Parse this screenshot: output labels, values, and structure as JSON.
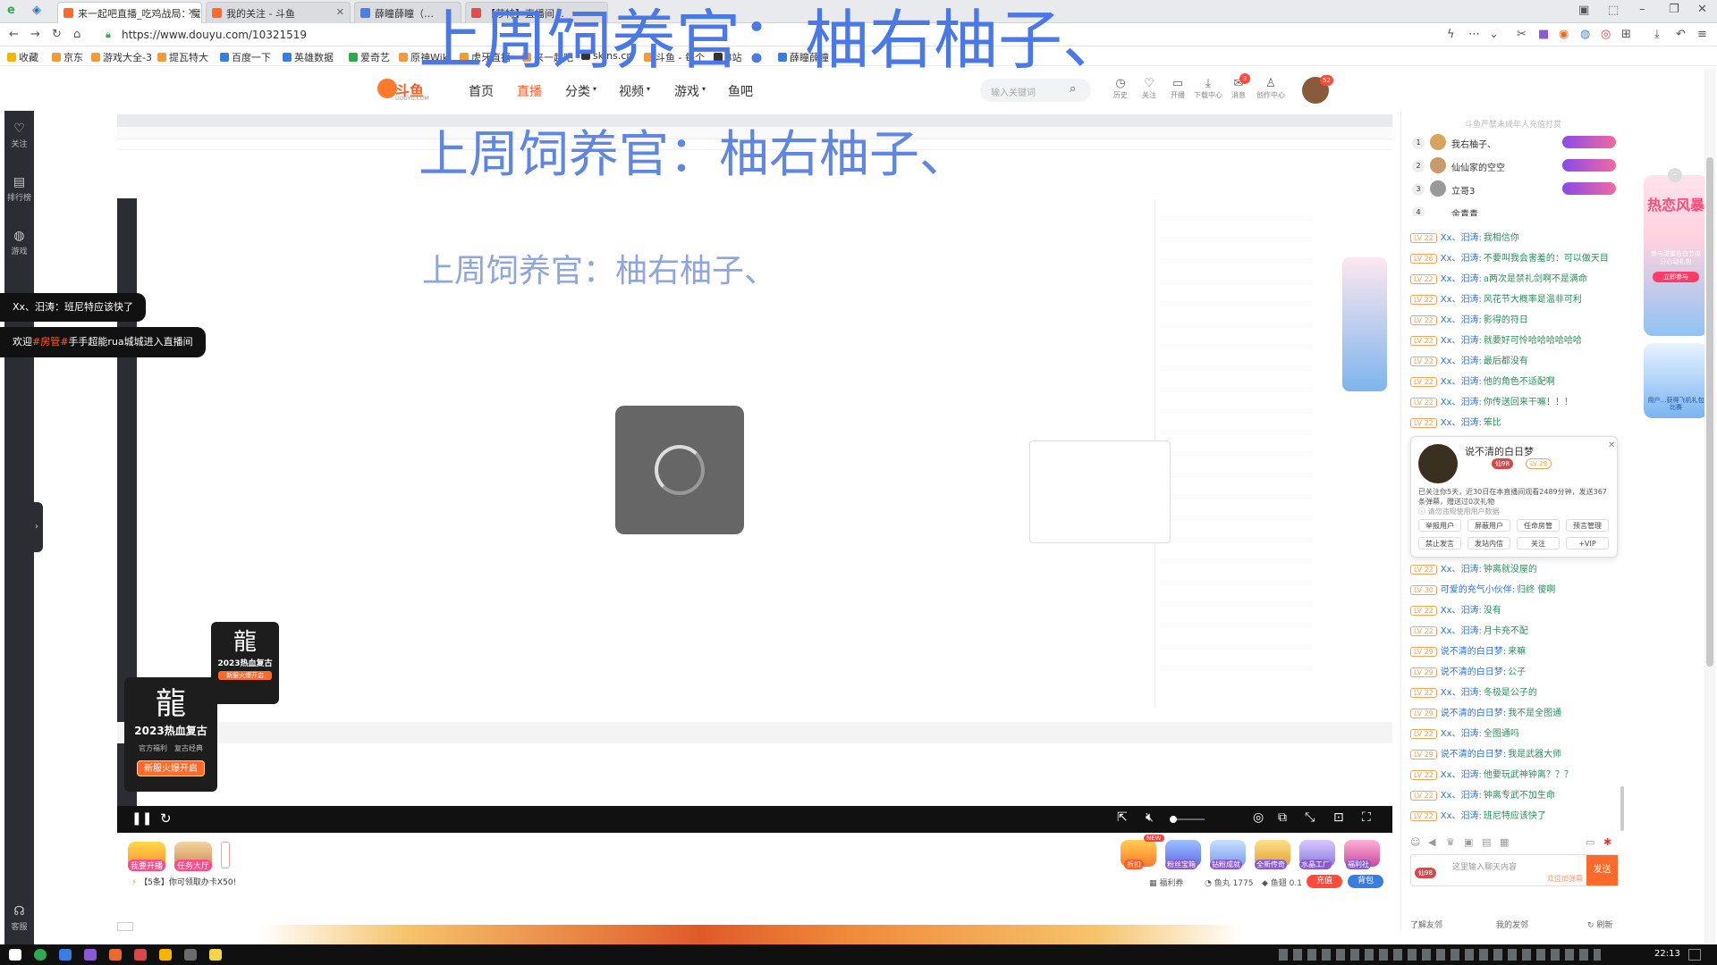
{
  "browser": {
    "tabs": [
      {
        "label": "来一起吧直播_吃鸡战局：魔方…",
        "active": true
      },
      {
        "label": "我的关注 - 斗鱼",
        "active": false
      },
      {
        "label": "薛瞳薛瞳（…",
        "active": false
      },
      {
        "label": "【莎特】直播间…",
        "active": false
      }
    ],
    "url": "https://www.douyu.com/10321519",
    "bookmarks": [
      "收藏",
      "京东",
      "游戏大全-3",
      "提瓦特大",
      "百度一下",
      "英雄数据",
      "爱奇艺",
      "原神Wiki",
      "虎牙直播",
      "来一起吧",
      "skins.cn",
      "斗鱼 - 每个",
      "B站",
      "薛瞳薛瞳"
    ]
  },
  "site": {
    "logo": "斗鱼",
    "logo_sub": "DOUYU.COM",
    "nav": [
      "首页",
      "直播",
      "分类",
      "视频",
      "游戏",
      "鱼吧"
    ],
    "search_placeholder": "输入关键词",
    "header_icons": [
      "历史",
      "关注",
      "开播",
      "下载中心",
      "消息",
      "创作中心"
    ],
    "notification_count": "3",
    "avatar_badge": "52"
  },
  "sidebar": [
    "关注",
    "排行榜",
    "游戏",
    "客服"
  ],
  "overlays": {
    "top_caption": "上周饲养官：柚右柚子、",
    "inner_caption": "上周饲养官：柚右柚子、",
    "toast_1": "Xx、汨涛：班尼特应该快了",
    "toast_2_prefix": "欢迎",
    "toast_2_highlight": "#房管#",
    "toast_2_suffix": "手手超能rua城城进入直播间"
  },
  "event_card": {
    "title": "2023热血复古",
    "tags": [
      "官方福利",
      "复古经典"
    ],
    "button": "新服火爆开启"
  },
  "bottom_gifts": {
    "left": [
      "我要开播",
      "任务大厅"
    ],
    "right": [
      "折扣",
      "粉丝宝箱",
      "钻粉成就",
      "全新传奇",
      "水晶工厂",
      "福利社"
    ],
    "new_badge": "NEW",
    "task_tip": "【5条】你可领取办卡X50!",
    "welfare": "福利券",
    "fish_ball": "鱼丸 1775",
    "fish_wing": "鱼翅 0.1",
    "recharge": "充值",
    "backpack": "背包"
  },
  "chat": {
    "notice": "斗鱼严禁未成年人充值打赏",
    "rank": [
      {
        "pos": "1",
        "name": "我右柚子、"
      },
      {
        "pos": "2",
        "name": "仙仙家的空空"
      },
      {
        "pos": "3",
        "name": "立哥3"
      },
      {
        "pos": "4",
        "name": "余青青"
      }
    ],
    "messages": [
      {
        "lv": "LV 22",
        "user": "Xx、汨涛:",
        "text": "我相信你"
      },
      {
        "lv": "LV 26",
        "user": "Xx、汨涛:",
        "text": "不要叫我会害羞的：可以做天目"
      },
      {
        "lv": "LV 22",
        "user": "Xx、汨涛:",
        "text": "a两次是禁礼剑啊不是满命"
      },
      {
        "lv": "LV 22",
        "user": "Xx、汨涛:",
        "text": "风花节大概率是温非可利"
      },
      {
        "lv": "LV 22",
        "user": "Xx、汨涛:",
        "text": "影得的符日"
      },
      {
        "lv": "LV 22",
        "user": "Xx、汨涛:",
        "text": "就要好可怜哈哈哈哈哈哈"
      },
      {
        "lv": "LV 22",
        "user": "Xx、汨涛:",
        "text": "最后都没有"
      },
      {
        "lv": "LV 22",
        "user": "Xx、汨涛:",
        "text": "他的角色不适配啊"
      },
      {
        "lv": "LV 22",
        "user": "Xx、汨涛:",
        "text": "你传送回来干嘛！！！"
      },
      {
        "lv": "LV 22",
        "user": "Xx、汨涛:",
        "text": "笨比"
      }
    ],
    "messages_2": [
      {
        "lv": "LV 22",
        "user": "Xx、汨涛:",
        "text": "钟离就没屋的"
      },
      {
        "lv": "LV 30",
        "user": "可爱的充气小伙伴:",
        "text": "归终 傻啊"
      },
      {
        "lv": "LV 22",
        "user": "Xx、汨涛:",
        "text": "没有"
      },
      {
        "lv": "LV 22",
        "user": "Xx、汨涛:",
        "text": "月卡充不配"
      },
      {
        "lv": "LV 29",
        "user": "说不清的白日梦:",
        "text": "来嘛"
      },
      {
        "lv": "LV 29",
        "user": "说不清的白日梦:",
        "text": "公子"
      },
      {
        "lv": "LV 22",
        "user": "Xx、汨涛:",
        "text": "冬极是公子的"
      },
      {
        "lv": "LV 29",
        "user": "说不清的白日梦:",
        "text": "我不是全图通"
      },
      {
        "lv": "LV 22",
        "user": "Xx、汨涛:",
        "text": "全图通吗"
      },
      {
        "lv": "LV 29",
        "user": "说不清的白日梦:",
        "text": "我是武器大师"
      },
      {
        "lv": "LV 22",
        "user": "Xx、汨涛:",
        "text": "他要玩武神钟离？？？"
      },
      {
        "lv": "LV 22",
        "user": "Xx、汨涛:",
        "text": "钟离专武不加生命"
      },
      {
        "lv": "LV 22",
        "user": "Xx、汨涛:",
        "text": "班尼特应该快了"
      }
    ],
    "user_card": {
      "name": "说不清的白日梦",
      "badge": "仙98",
      "level": "LV 29",
      "stats": "已关注你5天，近30日在本直播间观看2489分钟，发送367条弹幕，赠送过0次礼物",
      "privacy": "请勿违规使用用户数据",
      "actions": [
        "举报用户",
        "屏蔽用户",
        "任命房管",
        "预言管理",
        "禁止发言",
        "发站内信",
        "关注",
        "+VIP"
      ]
    },
    "input_placeholder": "这里输入聊天内容",
    "send": "发送",
    "camp": "欢迎加弹幕",
    "footer": [
      "了解友邻",
      "我的发邻",
      "刷新"
    ]
  },
  "promo": {
    "title": "热恋风暴",
    "subtitle": "参与甜蜜告白节瓜分心动礼包",
    "cta": "立即参与",
    "lower": "用户…获得飞机礼包 比赛"
  },
  "taskbar": {
    "time": "22:13"
  }
}
